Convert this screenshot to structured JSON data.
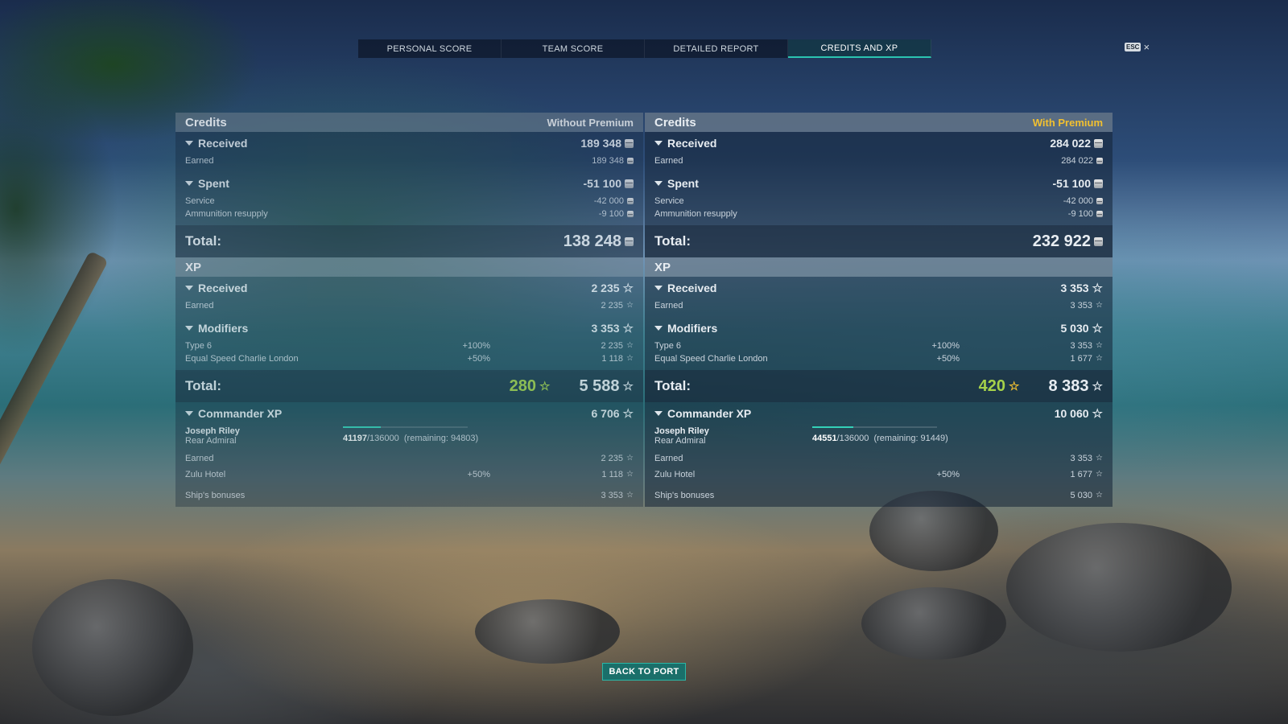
{
  "tabs": [
    {
      "label": "PERSONAL SCORE"
    },
    {
      "label": "TEAM SCORE"
    },
    {
      "label": "DETAILED REPORT"
    },
    {
      "label": "CREDITS AND XP"
    }
  ],
  "esc": {
    "key": "ESC",
    "close": "×"
  },
  "left": {
    "credits": {
      "title": "Credits",
      "mode": "Without Premium",
      "received": {
        "label": "Received",
        "value": "189 348",
        "earned_label": "Earned",
        "earned_value": "189 348"
      },
      "spent": {
        "label": "Spent",
        "value": "-51 100",
        "service_label": "Service",
        "service_value": "-42 000",
        "ammo_label": "Ammunition resupply",
        "ammo_value": "-9 100"
      },
      "total": {
        "label": "Total:",
        "value": "138 248"
      }
    },
    "xp": {
      "title": "XP",
      "received": {
        "label": "Received",
        "value": "2 235",
        "earned_label": "Earned",
        "earned_value": "2 235"
      },
      "modifiers": {
        "label": "Modifiers",
        "value": "3 353",
        "mod1_label": "Type 6",
        "mod1_pct": "+100%",
        "mod1_value": "2 235",
        "mod2_label": "Equal Speed Charlie London",
        "mod2_pct": "+50%",
        "mod2_value": "1 118"
      },
      "total": {
        "label": "Total:",
        "free": "280",
        "value": "5 588"
      },
      "commander": {
        "label": "Commander XP",
        "value": "6 706",
        "name": "Joseph Riley",
        "rank": "Rear Admiral",
        "progress_current": "41197",
        "progress_max": "/136000",
        "remaining": "(remaining: 94803)",
        "progress_fraction": 0.303,
        "earned_label": "Earned",
        "earned_value": "2 235",
        "hotel_label": "Zulu Hotel",
        "hotel_pct": "+50%",
        "hotel_value": "1 118",
        "bonus_label": "Ship's bonuses",
        "bonus_value": "3 353"
      }
    }
  },
  "right": {
    "credits": {
      "title": "Credits",
      "mode": "With Premium",
      "received": {
        "label": "Received",
        "value": "284 022",
        "earned_label": "Earned",
        "earned_value": "284 022"
      },
      "spent": {
        "label": "Spent",
        "value": "-51 100",
        "service_label": "Service",
        "service_value": "-42 000",
        "ammo_label": "Ammunition resupply",
        "ammo_value": "-9 100"
      },
      "total": {
        "label": "Total:",
        "value": "232 922"
      }
    },
    "xp": {
      "title": "XP",
      "received": {
        "label": "Received",
        "value": "3 353",
        "earned_label": "Earned",
        "earned_value": "3 353"
      },
      "modifiers": {
        "label": "Modifiers",
        "value": "5 030",
        "mod1_label": "Type 6",
        "mod1_pct": "+100%",
        "mod1_value": "3 353",
        "mod2_label": "Equal Speed Charlie London",
        "mod2_pct": "+50%",
        "mod2_value": "1 677"
      },
      "total": {
        "label": "Total:",
        "free": "420",
        "value": "8 383"
      },
      "commander": {
        "label": "Commander XP",
        "value": "10 060",
        "name": "Joseph Riley",
        "rank": "Rear Admiral",
        "progress_current": "44551",
        "progress_max": "/136000",
        "remaining": "(remaining: 91449)",
        "progress_fraction": 0.328,
        "earned_label": "Earned",
        "earned_value": "3 353",
        "hotel_label": "Zulu Hotel",
        "hotel_pct": "+50%",
        "hotel_value": "1 677",
        "bonus_label": "Ship's bonuses",
        "bonus_value": "5 030"
      }
    }
  },
  "back_button": "BACK TO PORT",
  "colors": {
    "premium": "#f2c030",
    "free_xp": "#a6d24a",
    "accent": "#2bc4b0"
  }
}
